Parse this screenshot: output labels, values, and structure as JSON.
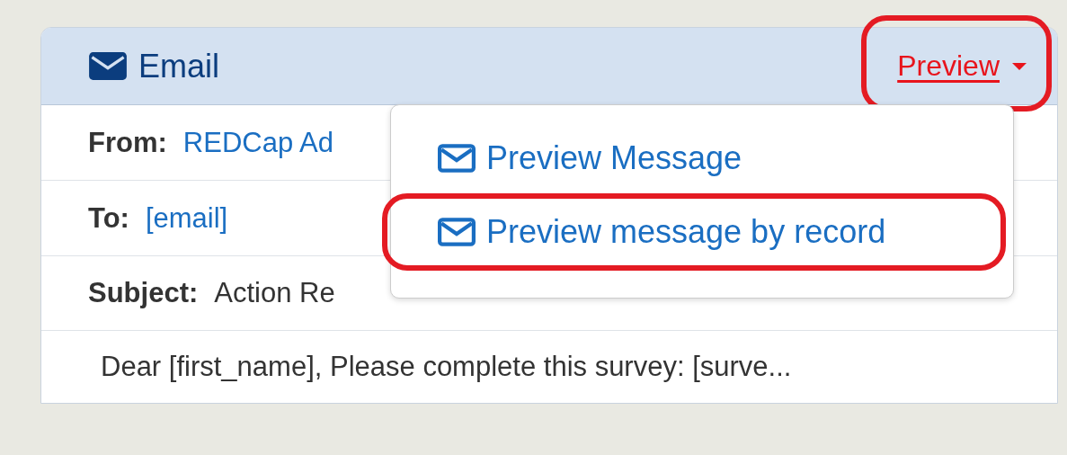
{
  "panel": {
    "title": "Email",
    "preview_button": {
      "label": "Preview",
      "highlighted": true,
      "expanded": true
    },
    "fields": [
      {
        "label": "From:",
        "value": "REDCap Ad",
        "kind": "link"
      },
      {
        "label": "To:",
        "value": "[email]",
        "kind": "link"
      },
      {
        "label": "Subject:",
        "value": "Action Re",
        "kind": "text"
      }
    ],
    "body": "Dear [first_name], Please complete this survey: [surve...",
    "menu": [
      {
        "label": "Preview Message",
        "highlighted": false
      },
      {
        "label": "Preview message by record",
        "highlighted": true
      }
    ]
  }
}
